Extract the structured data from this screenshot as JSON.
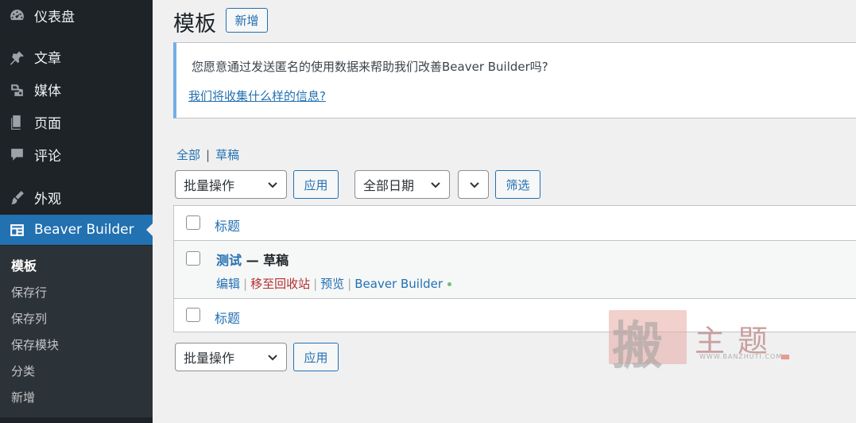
{
  "sidebar": {
    "items": [
      {
        "label": "仪表盘",
        "icon": "dashboard-icon"
      },
      {
        "label": "文章",
        "icon": "pin-icon"
      },
      {
        "label": "媒体",
        "icon": "media-icon"
      },
      {
        "label": "页面",
        "icon": "page-icon"
      },
      {
        "label": "评论",
        "icon": "comment-icon"
      },
      {
        "label": "外观",
        "icon": "paintbrush-icon"
      },
      {
        "label": "Beaver Builder",
        "icon": "layout-icon"
      }
    ],
    "submenu": [
      "模板",
      "保存行",
      "保存列",
      "保存模块",
      "分类",
      "新增"
    ]
  },
  "header": {
    "title": "模板",
    "add_new": "新增"
  },
  "notice": {
    "message": "您愿意通过发送匿名的使用数据来帮助我们改善Beaver Builder吗?",
    "link": "我们将收集什么样的信息?"
  },
  "filters": {
    "views": [
      "全部",
      "草稿"
    ],
    "bulk_action": "批量操作",
    "apply": "应用",
    "date": "全部日期",
    "filter": "筛选"
  },
  "table": {
    "column_title": "标题",
    "rows": [
      {
        "title": "测试",
        "state": "— 草稿",
        "actions": [
          "编辑",
          "移至回收站",
          "预览",
          "Beaver Builder"
        ]
      }
    ]
  },
  "watermark": {
    "big": "搬",
    "text": "主题",
    "url": "WWW.BANZHUTI.COM"
  },
  "colors": {
    "accent": "#2271b1",
    "sidebar": "#1d2327",
    "trash": "#b32d2e"
  }
}
